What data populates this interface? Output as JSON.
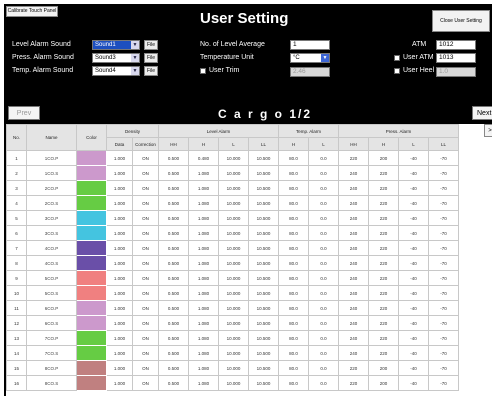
{
  "header": {
    "calibrate_label": "Calibrate Touch Panel",
    "title": "User Setting",
    "close_label": "Close User Setting"
  },
  "settings": {
    "level_alarm_sound": {
      "label": "Level Alarm Sound",
      "value": "Sound1",
      "file_label": "File"
    },
    "press_alarm_sound": {
      "label": "Press. Alarm Sound",
      "value": "Sound3",
      "file_label": "File"
    },
    "temp_alarm_sound": {
      "label": "Temp. Alarm Sound",
      "value": "Sound4",
      "file_label": "File"
    },
    "level_average": {
      "label": "No. of Level Average",
      "value": "1"
    },
    "temp_unit": {
      "label": "Temperature Unit",
      "value": "°C"
    },
    "user_trim": {
      "label": "User Trim",
      "value": "2.46"
    },
    "atm": {
      "label": "ATM",
      "value": "1012"
    },
    "user_atm": {
      "label": "User ATM",
      "value": "1013"
    },
    "user_heel": {
      "label": "User Heel",
      "value": "1.0"
    }
  },
  "nav": {
    "prev_label": "Prev",
    "next_label": "Next",
    "cargo_title": "C a r g o  1/2",
    "more_label": ">"
  },
  "table": {
    "group_headers": {
      "no": "No.",
      "name": "Name",
      "color": "Color",
      "density": "Density",
      "level_alarm": "Level Alarm",
      "temp_alarm": "Temp. Alarm",
      "press_alarm": "Press. Alarm"
    },
    "sub_headers": {
      "data": "Data",
      "correction": "Correction",
      "hh": "HH",
      "h": "H",
      "l": "L",
      "ll": "LL"
    },
    "rows": [
      {
        "no": "1",
        "name": "1CO.P",
        "color": "#cc99cc",
        "density": "1.000",
        "corr": "ON",
        "lhh": "0.500",
        "lh": "0.480",
        "ll": "10.000",
        "lll": "10.500",
        "th": "80.0",
        "tl": "0.0",
        "phh": "220",
        "ph": "200",
        "pl": "-40",
        "pll": "-70"
      },
      {
        "no": "2",
        "name": "1CO.S",
        "color": "#cc99cc",
        "density": "1.000",
        "corr": "ON",
        "lhh": "0.500",
        "lh": "1.080",
        "ll": "10.000",
        "lll": "10.500",
        "th": "80.0",
        "tl": "0.0",
        "phh": "240",
        "ph": "220",
        "pl": "-40",
        "pll": "-70"
      },
      {
        "no": "3",
        "name": "2CO.P",
        "color": "#66cc44",
        "density": "1.000",
        "corr": "ON",
        "lhh": "0.500",
        "lh": "1.080",
        "ll": "10.000",
        "lll": "10.500",
        "th": "80.0",
        "tl": "0.0",
        "phh": "240",
        "ph": "220",
        "pl": "-40",
        "pll": "-70"
      },
      {
        "no": "4",
        "name": "2CO.S",
        "color": "#66cc44",
        "density": "1.000",
        "corr": "ON",
        "lhh": "0.500",
        "lh": "1.080",
        "ll": "10.000",
        "lll": "10.500",
        "th": "80.0",
        "tl": "0.0",
        "phh": "240",
        "ph": "220",
        "pl": "-40",
        "pll": "-70"
      },
      {
        "no": "5",
        "name": "3CO.P",
        "color": "#44c4e0",
        "density": "1.000",
        "corr": "ON",
        "lhh": "0.500",
        "lh": "1.080",
        "ll": "10.000",
        "lll": "10.500",
        "th": "80.0",
        "tl": "0.0",
        "phh": "240",
        "ph": "220",
        "pl": "-40",
        "pll": "-70"
      },
      {
        "no": "6",
        "name": "3CO.S",
        "color": "#44c4e0",
        "density": "1.000",
        "corr": "ON",
        "lhh": "0.500",
        "lh": "1.080",
        "ll": "10.000",
        "lll": "10.500",
        "th": "80.0",
        "tl": "0.0",
        "phh": "240",
        "ph": "220",
        "pl": "-40",
        "pll": "-70"
      },
      {
        "no": "7",
        "name": "4CO.P",
        "color": "#6a4fa8",
        "density": "1.000",
        "corr": "ON",
        "lhh": "0.500",
        "lh": "1.080",
        "ll": "10.000",
        "lll": "10.500",
        "th": "80.0",
        "tl": "0.0",
        "phh": "240",
        "ph": "220",
        "pl": "-40",
        "pll": "-70"
      },
      {
        "no": "8",
        "name": "4CO.S",
        "color": "#6a4fa8",
        "density": "1.000",
        "corr": "ON",
        "lhh": "0.500",
        "lh": "1.080",
        "ll": "10.000",
        "lll": "10.500",
        "th": "80.0",
        "tl": "0.0",
        "phh": "240",
        "ph": "220",
        "pl": "-40",
        "pll": "-70"
      },
      {
        "no": "9",
        "name": "5CO.P",
        "color": "#f08080",
        "density": "1.000",
        "corr": "ON",
        "lhh": "0.500",
        "lh": "1.080",
        "ll": "10.000",
        "lll": "10.500",
        "th": "80.0",
        "tl": "0.0",
        "phh": "240",
        "ph": "220",
        "pl": "-40",
        "pll": "-70"
      },
      {
        "no": "10",
        "name": "5CO.S",
        "color": "#f08080",
        "density": "1.000",
        "corr": "ON",
        "lhh": "0.500",
        "lh": "1.080",
        "ll": "10.000",
        "lll": "10.500",
        "th": "80.0",
        "tl": "0.0",
        "phh": "240",
        "ph": "220",
        "pl": "-40",
        "pll": "-70"
      },
      {
        "no": "11",
        "name": "6CO.P",
        "color": "#cc99cc",
        "density": "1.000",
        "corr": "ON",
        "lhh": "0.500",
        "lh": "1.080",
        "ll": "10.000",
        "lll": "10.500",
        "th": "80.0",
        "tl": "0.0",
        "phh": "240",
        "ph": "220",
        "pl": "-40",
        "pll": "-70"
      },
      {
        "no": "12",
        "name": "6CO.S",
        "color": "#cc99cc",
        "density": "1.000",
        "corr": "ON",
        "lhh": "0.500",
        "lh": "1.080",
        "ll": "10.000",
        "lll": "10.500",
        "th": "80.0",
        "tl": "0.0",
        "phh": "240",
        "ph": "220",
        "pl": "-40",
        "pll": "-70"
      },
      {
        "no": "13",
        "name": "7CO.P",
        "color": "#66cc44",
        "density": "1.000",
        "corr": "ON",
        "lhh": "0.500",
        "lh": "1.080",
        "ll": "10.000",
        "lll": "10.500",
        "th": "80.0",
        "tl": "0.0",
        "phh": "240",
        "ph": "220",
        "pl": "-40",
        "pll": "-70"
      },
      {
        "no": "14",
        "name": "7CO.S",
        "color": "#66cc44",
        "density": "1.000",
        "corr": "ON",
        "lhh": "0.500",
        "lh": "1.080",
        "ll": "10.000",
        "lll": "10.500",
        "th": "80.0",
        "tl": "0.0",
        "phh": "240",
        "ph": "220",
        "pl": "-40",
        "pll": "-70"
      },
      {
        "no": "15",
        "name": "8CO.P",
        "color": "#c08080",
        "density": "1.000",
        "corr": "ON",
        "lhh": "0.500",
        "lh": "1.080",
        "ll": "10.000",
        "lll": "10.500",
        "th": "80.0",
        "tl": "0.0",
        "phh": "220",
        "ph": "200",
        "pl": "-40",
        "pll": "-70"
      },
      {
        "no": "16",
        "name": "8CO.S",
        "color": "#c08080",
        "density": "1.000",
        "corr": "ON",
        "lhh": "0.500",
        "lh": "1.080",
        "ll": "10.000",
        "lll": "10.500",
        "th": "80.0",
        "tl": "0.0",
        "phh": "220",
        "ph": "200",
        "pl": "-40",
        "pll": "-70"
      }
    ]
  }
}
